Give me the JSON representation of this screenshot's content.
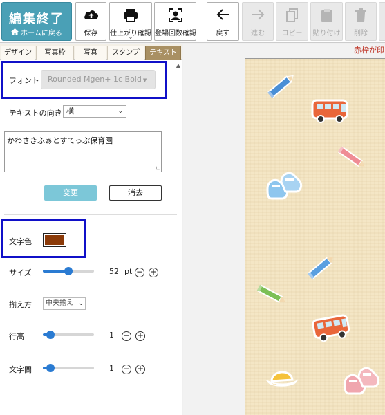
{
  "toolbar": {
    "end_button": {
      "title": "編集終了",
      "sub": "ホームに戻る"
    },
    "buttons": [
      {
        "label": "保存",
        "icon": "cloud-upload-icon",
        "enabled": true
      },
      {
        "label": "仕上がり確認",
        "icon": "printer-icon",
        "enabled": true,
        "has_dropdown": true
      },
      {
        "label": "登場回数確認",
        "icon": "person-frame-icon",
        "enabled": true
      },
      {
        "label": "戻す",
        "icon": "arrow-left-icon",
        "enabled": true
      },
      {
        "label": "進む",
        "icon": "arrow-right-icon",
        "enabled": false
      },
      {
        "label": "コピー",
        "icon": "copy-icon",
        "enabled": false
      },
      {
        "label": "貼り付け",
        "icon": "clipboard-icon",
        "enabled": false
      },
      {
        "label": "削除",
        "icon": "trash-icon",
        "enabled": false
      }
    ]
  },
  "tabs": [
    {
      "label": "デザイン",
      "active": false
    },
    {
      "label": "写真枠",
      "active": false
    },
    {
      "label": "写真",
      "active": false
    },
    {
      "label": "スタンプ",
      "active": false
    },
    {
      "label": "テキスト",
      "active": true
    }
  ],
  "text_panel": {
    "font_label": "フォント",
    "font_value": "Rounded Mgen+ 1c Bold",
    "direction_label": "テキストの向き",
    "direction_value": "横",
    "text_value": "かわさきふぁとすてっぷ保育園",
    "change_button": "変更",
    "clear_button": "消去",
    "color_label": "文字色",
    "color_value": "#8b3a08",
    "size_label": "サイズ",
    "size_value": "52",
    "size_unit": "pt",
    "size_level": 0.5,
    "align_label": "揃え方",
    "align_value": "中央揃え",
    "line_height_label": "行高",
    "line_height_value": "1",
    "line_height_level": 0.15,
    "letter_spacing_label": "文字間",
    "letter_spacing_value": "1",
    "letter_spacing_level": 0.15
  },
  "canvas": {
    "notice": "赤枠が印",
    "stickers": [
      "pencil-blue",
      "bus-orange",
      "pencil-pink",
      "shoes-blue",
      "pencil-blue",
      "pencil-green",
      "bus-orange",
      "hat-yellow",
      "shoes-pink"
    ]
  },
  "colors": {
    "accent": "#4aa0b6",
    "highlight": "#1010c8",
    "slider": "#2a7bd2",
    "active_tab": "#a99063",
    "notice": "#c0392b"
  }
}
